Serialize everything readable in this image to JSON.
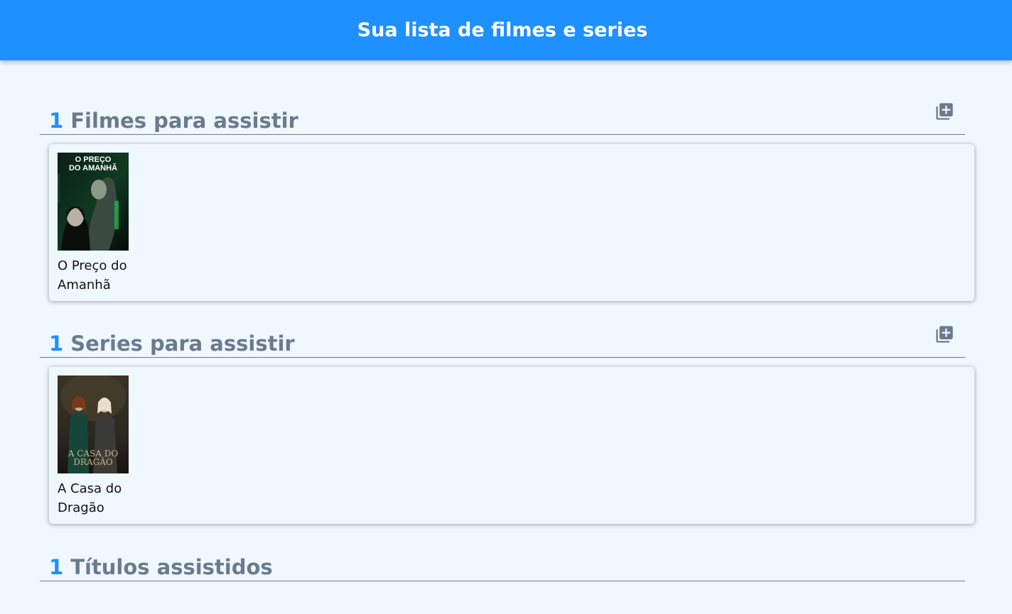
{
  "header": {
    "title": "Sua lista de filmes e series"
  },
  "sections": [
    {
      "count": "1",
      "title": "Filmes para assistir",
      "items": [
        {
          "title": "O Preço do Amanhã",
          "poster_text_1": "O PREÇO",
          "poster_text_2": "DO AMANHÃ"
        }
      ]
    },
    {
      "count": "1",
      "title": "Series para assistir",
      "items": [
        {
          "title": "A Casa do Dragão",
          "poster_text_1": "A CASA DO",
          "poster_text_2": "DRAGÃO"
        }
      ]
    },
    {
      "count": "1",
      "title": "Títulos assistidos",
      "items": []
    }
  ],
  "colors": {
    "accent": "#1e90ff",
    "background": "#eff7ff",
    "section_title": "#6b7b8d"
  },
  "icons": {
    "add": "library-add-icon"
  }
}
